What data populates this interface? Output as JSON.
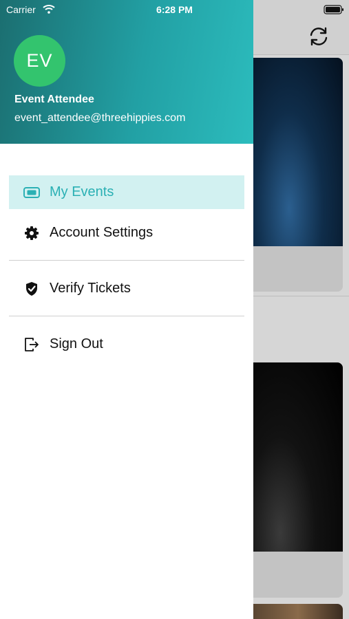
{
  "status_bar": {
    "carrier": "Carrier",
    "time": "6:28 PM"
  },
  "profile": {
    "initials": "EV",
    "name": "Event Attendee",
    "email": "event_attendee@threehippies.com",
    "avatar_color": "#33c46e",
    "header_gradient": [
      "#1b6e70",
      "#2cbcbd"
    ]
  },
  "menu": {
    "items": [
      {
        "label": "My Events",
        "icon": "ticket-icon",
        "active": true
      },
      {
        "label": "Account Settings",
        "icon": "gear-icon",
        "active": false
      },
      {
        "label": "Verify Tickets",
        "icon": "shield-check-icon",
        "active": false
      },
      {
        "label": "Sign Out",
        "icon": "sign-out-icon",
        "active": false
      }
    ],
    "accent_color": "#2ab0b4",
    "active_background": "#d2f1f1"
  },
  "background_app": {
    "toolbar_icon": "sync-icon"
  }
}
